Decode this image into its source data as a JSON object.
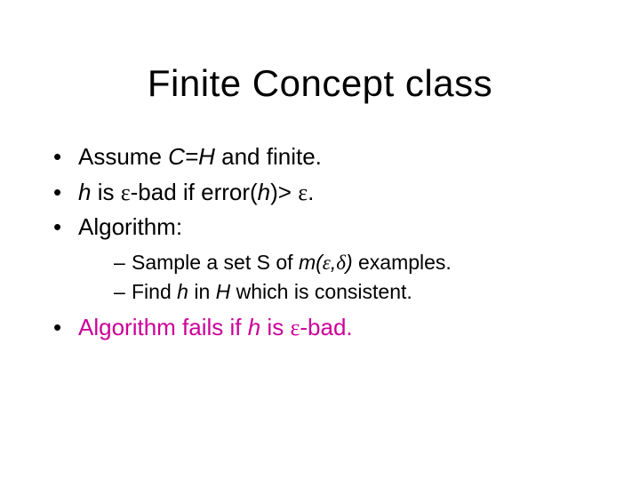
{
  "title": "Finite Concept class",
  "bullets": {
    "b1_pre": "Assume ",
    "b1_ital": "C=H",
    "b1_post": " and finite.",
    "b2_h": "h",
    "b2_a": " is ",
    "b2_eps1": "ε",
    "b2_b": "-bad if error(",
    "b2_h2": "h",
    "b2_c": ")> ",
    "b2_eps2": "ε",
    "b2_d": ".",
    "b3": "Algorithm:",
    "s1_a": "Sample a set S of ",
    "s1_m": "m(",
    "s1_eps": "ε",
    "s1_comma": ",",
    "s1_delta": "δ",
    "s1_close": ")",
    "s1_b": " examples.",
    "s2_a": "Find ",
    "s2_h": "h",
    "s2_b": " in ",
    "s2_H": "H",
    "s2_c": " which is consistent.",
    "b4_a": "Algorithm fails if ",
    "b4_h": "h",
    "b4_b": " is ",
    "b4_eps": "ε",
    "b4_c": "-bad."
  }
}
